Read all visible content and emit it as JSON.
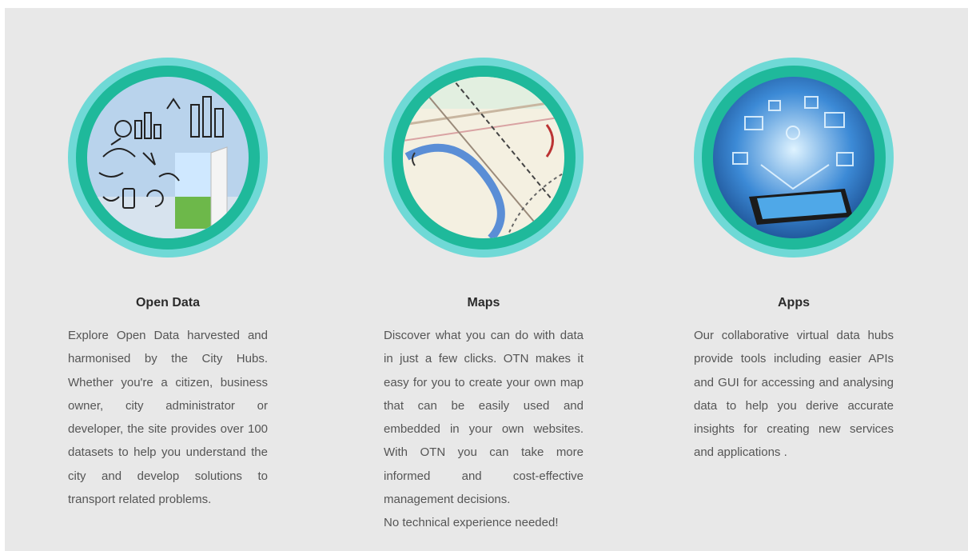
{
  "features": [
    {
      "title": "Open Data",
      "image_icon": "open-data-illustration",
      "description": "Explore Open Data harvested and harmonised by the City Hubs. Whether you're a citizen, business owner, city administrator or developer, the site provides over 100 datasets to help you understand the city and develop solutions to transport related problems."
    },
    {
      "title": "Maps",
      "image_icon": "map-illustration",
      "description": "Discover what you can do with data in just a few clicks. OTN makes it easy for you to create your own map that can be easily used and embedded in your own websites. With OTN you can take more informed and cost-effective management decisions.",
      "extra": "No technical experience needed!"
    },
    {
      "title": "Apps",
      "image_icon": "apps-tablet-illustration",
      "description": "Our collaborative virtual data hubs provide tools including easier APIs and GUI for accessing and analysing data to help you derive accurate insights for creating new services and applications ."
    }
  ],
  "colors": {
    "panel_bg": "#e8e8e8",
    "outer_ring": "#6fd9d6",
    "inner_ring": "#1fb99b",
    "title": "#2b2b2b",
    "text": "#555555"
  }
}
